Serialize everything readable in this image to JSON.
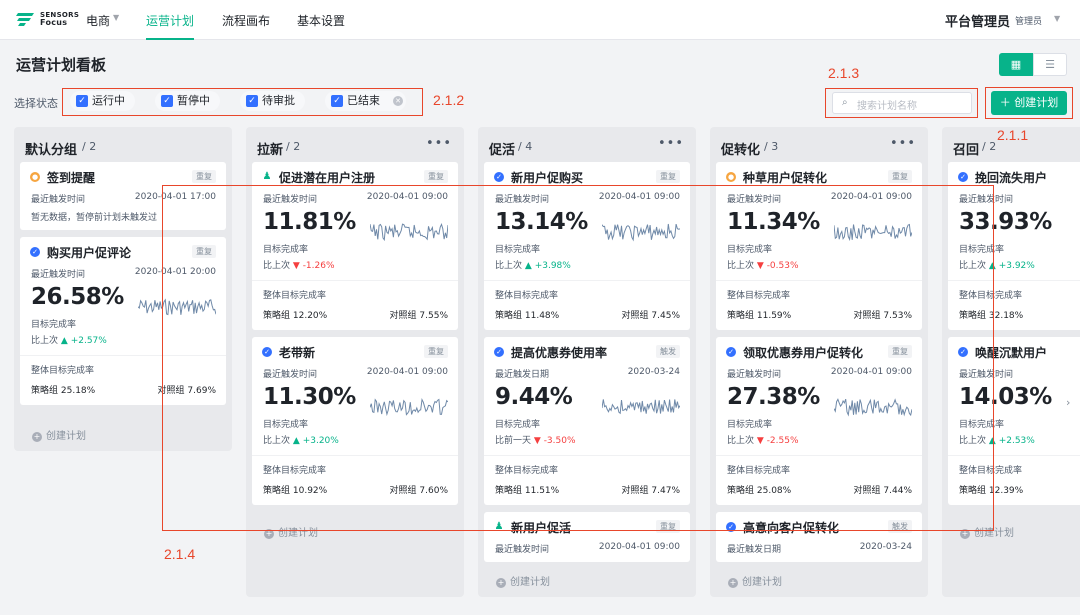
{
  "header": {
    "brand_top": "SENSORS",
    "brand_bottom": "Focus",
    "project": "电商",
    "nav": [
      "运营计划",
      "流程画布",
      "基本设置"
    ],
    "platform": "平台管理员",
    "role": "管理员"
  },
  "page": {
    "title": "运营计划看板",
    "filter_label": "选择状态",
    "statuses": [
      "运行中",
      "暂停中",
      "待审批",
      "已结束"
    ],
    "search_placeholder": "搜索计划名称",
    "create_label": "创建计划",
    "view_grid_icon": "grid-icon",
    "view_list_icon": "list-icon"
  },
  "annotations": {
    "a212": "2.1.2",
    "a213": "2.1.3",
    "a211": "2.1.1",
    "a214": "2.1.4"
  },
  "colors": {
    "accent": "#07b38a",
    "checkbox": "#3370ff",
    "up": "#07b38a",
    "down": "#f53f3f",
    "annotation": "#e8462b"
  },
  "common": {
    "last_trigger_time": "最近触发时间",
    "last_trigger_date": "最近触发日期",
    "target_rate": "目标完成率",
    "overall_rate": "整体目标完成率",
    "strategy": "策略组",
    "control": "对照组",
    "vs_last": "比上次",
    "vs_prev_day": "比前一天",
    "create_plan": "创建计划",
    "tag_repeat": "重复",
    "tag_trigger": "触发"
  },
  "columns": {
    "default": {
      "title": "默认分组",
      "count": "/ 2",
      "cards": {
        "c1": {
          "name": "签到提醒",
          "tag": "重复",
          "time": "2020-04-01 17:00",
          "note": "暂无数据，暂停前计划未触发过",
          "icon": "clock-icon"
        },
        "c2": {
          "name": "购买用户促评论",
          "tag": "重复",
          "time": "2020-04-01 20:00",
          "pct": "26.58%",
          "delta": "+2.57%",
          "strategy": "25.18%",
          "control": "7.69%",
          "icon": "check-icon"
        }
      }
    },
    "laxin": {
      "title": "拉新",
      "count": "/ 2",
      "cards": {
        "c1": {
          "name": "促进潜在用户注册",
          "tag": "重复",
          "time": "2020-04-01 09:00",
          "pct": "11.81%",
          "delta": "-1.26%",
          "strategy": "12.20%",
          "control": "7.55%",
          "icon": "person-icon"
        },
        "c2": {
          "name": "老带新",
          "tag": "重复",
          "time": "2020-04-01 09:00",
          "pct": "11.30%",
          "delta": "+3.20%",
          "strategy": "10.92%",
          "control": "7.60%",
          "icon": "check-icon"
        }
      }
    },
    "cuhuo": {
      "title": "促活",
      "count": "/ 4",
      "cards": {
        "c1": {
          "name": "新用户促购买",
          "tag": "重复",
          "time": "2020-04-01 09:00",
          "pct": "13.14%",
          "delta": "+3.98%",
          "strategy": "11.48%",
          "control": "7.45%",
          "icon": "check-icon"
        },
        "c2": {
          "name": "提高优惠券使用率",
          "tag": "触发",
          "time": "2020-03-24",
          "pct": "9.44%",
          "delta": "-3.50%",
          "strategy": "11.51%",
          "control": "7.47%",
          "icon": "check-icon"
        },
        "c3": {
          "name": "新用户促活",
          "tag": "重复",
          "time": "2020-04-01 09:00",
          "icon": "person-icon"
        }
      }
    },
    "cuzhuan": {
      "title": "促转化",
      "count": "/ 3",
      "cards": {
        "c1": {
          "name": "种草用户促转化",
          "tag": "重复",
          "time": "2020-04-01 09:00",
          "pct": "11.34%",
          "delta": "-0.53%",
          "strategy": "11.59%",
          "control": "7.53%",
          "icon": "clock-icon"
        },
        "c2": {
          "name": "领取优惠券用户促转化",
          "tag": "重复",
          "time": "2020-04-01 09:00",
          "pct": "27.38%",
          "delta": "-2.55%",
          "strategy": "25.08%",
          "control": "7.44%",
          "icon": "check-icon"
        },
        "c3": {
          "name": "高意向客户促转化",
          "tag": "触发",
          "time": "2020-03-24",
          "icon": "check-icon"
        }
      }
    },
    "zhaohui": {
      "title": "召回",
      "count": "/ 2",
      "cards": {
        "c1": {
          "name": "挽回流失用户",
          "pct": "33.93%",
          "delta": "+3.92%",
          "strategy": "32.18%",
          "icon": "check-icon"
        },
        "c2": {
          "name": "唤醒沉默用户",
          "pct": "14.03%",
          "delta": "+2.53%",
          "strategy": "12.39%",
          "icon": "check-icon"
        }
      }
    }
  }
}
